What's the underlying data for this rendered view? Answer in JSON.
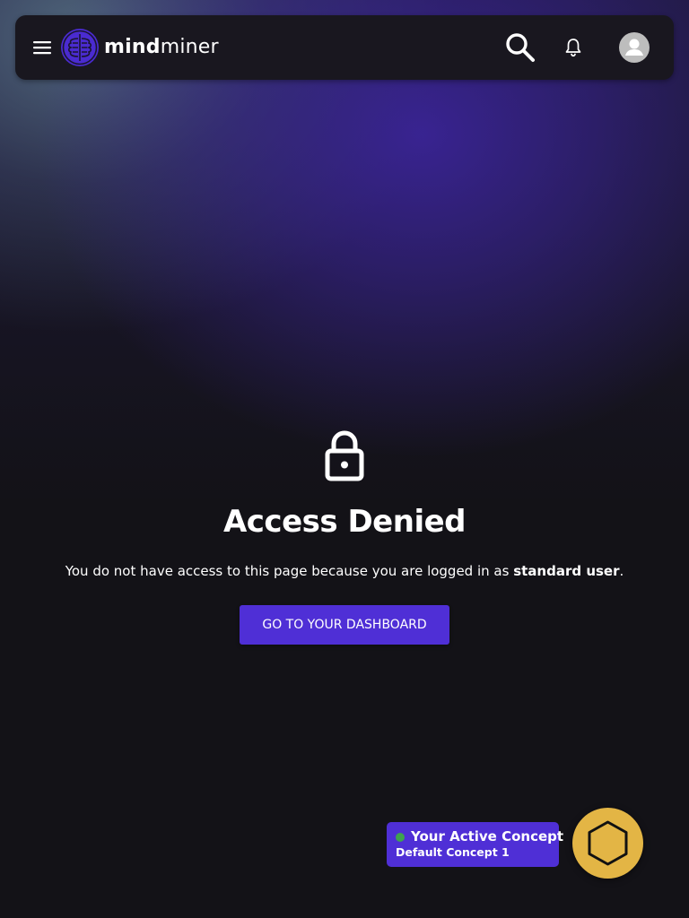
{
  "header": {
    "brand_bold": "mind",
    "brand_light": "miner",
    "icons": {
      "menu": "hamburger-menu-icon",
      "logo": "brain-logo-icon",
      "search": "search-icon",
      "notifications": "bell-icon",
      "account": "user-avatar-icon"
    }
  },
  "main": {
    "icon": "lock-icon",
    "title": "Access Denied",
    "message_prefix": "You do not have access to this page because you are logged in as ",
    "message_role": "standard user",
    "message_suffix": ".",
    "dashboard_button_label": "GO TO YOUR DASHBOARD"
  },
  "concept": {
    "title": "Your Active Concept",
    "name": "Default Concept 1",
    "status_color": "#3ea34f",
    "fab_icon": "hexagon-icon"
  },
  "colors": {
    "accent": "#4f2fd6",
    "background": "#131217",
    "header_bg": "#19171f",
    "fab": "#e3b545"
  }
}
